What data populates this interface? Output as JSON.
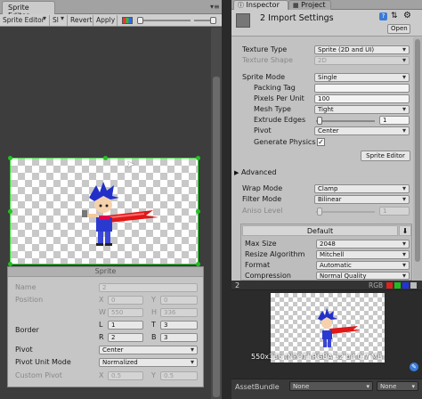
{
  "sprite_editor": {
    "tab_title": "Sprite Editor",
    "toolbar": {
      "mode_dropdown": "Sprite Editor",
      "slice_dropdown": "Sl",
      "revert_label": "Revert",
      "apply_label": "Apply"
    },
    "sprite_panel": {
      "title": "Sprite",
      "name_label": "Name",
      "name_value": "2",
      "position_label": "Position",
      "x_label": "X",
      "x_value": "0",
      "y_label": "Y",
      "y_value": "0",
      "w_label": "W",
      "w_value": "550",
      "h_label": "H",
      "h_value": "336",
      "border_label": "Border",
      "l_label": "L",
      "l_value": "1",
      "t_label": "T",
      "t_value": "3",
      "r_label": "R",
      "r_value": "2",
      "b_label": "B",
      "b_value": "3",
      "pivot_label": "Pivot",
      "pivot_value": "Center",
      "pivot_unit_label": "Pivot Unit Mode",
      "pivot_unit_value": "Normalized",
      "custom_pivot_label": "Custom Pivot",
      "cx_label": "X",
      "cx_value": "0.5",
      "cy_label": "Y",
      "cy_value": "0.5"
    }
  },
  "inspector": {
    "tab_inspector": "Inspector",
    "tab_project": "Project",
    "header_title": "2 Import Settings",
    "open_label": "Open",
    "texture_type_label": "Texture Type",
    "texture_type_value": "Sprite (2D and UI)",
    "texture_shape_label": "Texture Shape",
    "texture_shape_value": "2D",
    "sprite_mode_label": "Sprite Mode",
    "sprite_mode_value": "Single",
    "packing_tag_label": "Packing Tag",
    "packing_tag_value": "",
    "ppu_label": "Pixels Per Unit",
    "ppu_value": "100",
    "mesh_type_label": "Mesh Type",
    "mesh_type_value": "Tight",
    "extrude_label": "Extrude Edges",
    "extrude_value": "1",
    "pivot_label": "Pivot",
    "pivot_value": "Center",
    "gen_physics_label": "Generate Physics",
    "sprite_editor_button": "Sprite Editor",
    "advanced_label": "Advanced",
    "wrap_mode_label": "Wrap Mode",
    "wrap_mode_value": "Clamp",
    "filter_mode_label": "Filter Mode",
    "filter_mode_value": "Bilinear",
    "aniso_label": "Aniso Level",
    "aniso_value": "1",
    "platform_default_tab": "Default",
    "max_size_label": "Max Size",
    "max_size_value": "2048",
    "resize_label": "Resize Algorithm",
    "resize_value": "Mitchell",
    "format_label": "Format",
    "format_value": "Automatic",
    "compression_label": "Compression",
    "compression_value": "Normal Quality",
    "preview_title": "2",
    "preview_channels": "RGB",
    "preview_info": "550x336 (NPOT)  RGBA 32 bit  0.7 MB",
    "assetbundle_label": "AssetBundle",
    "assetbundle_value": "None",
    "assetbundle_variant": "None"
  }
}
